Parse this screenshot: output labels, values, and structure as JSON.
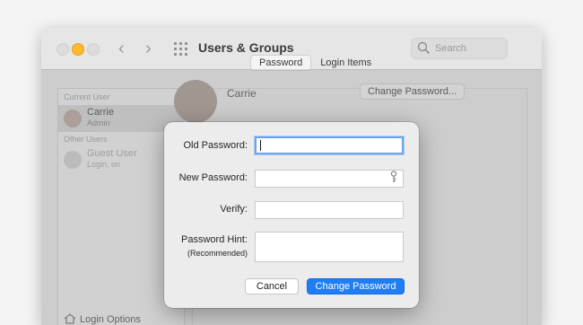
{
  "window": {
    "title": "Users & Groups"
  },
  "toolbar": {
    "search_placeholder": "Search"
  },
  "sidebar": {
    "current_user_label": "Current User",
    "current_user": {
      "name": "Carrie",
      "role": "Admin"
    },
    "other_users_label": "Other Users",
    "guest_user": {
      "name": "Guest User",
      "status": "Login, on"
    },
    "login_options": "Login Options"
  },
  "main": {
    "tabs": [
      "Password",
      "Login Items"
    ],
    "user_name": "Carrie",
    "change_password_button": "Change Password..."
  },
  "dialog": {
    "old_password_label": "Old Password:",
    "old_password_value": "",
    "new_password_label": "New Password:",
    "new_password_value": "",
    "verify_label": "Verify:",
    "verify_value": "",
    "hint_label": "Password Hint:",
    "hint_sublabel": "(Recommended)",
    "hint_value": "",
    "cancel_button": "Cancel",
    "change_button": "Change Password"
  },
  "colors": {
    "accent": "#1f7ef5",
    "focus_ring": "#6fa3e8",
    "minimize": "#fdbc2e"
  }
}
